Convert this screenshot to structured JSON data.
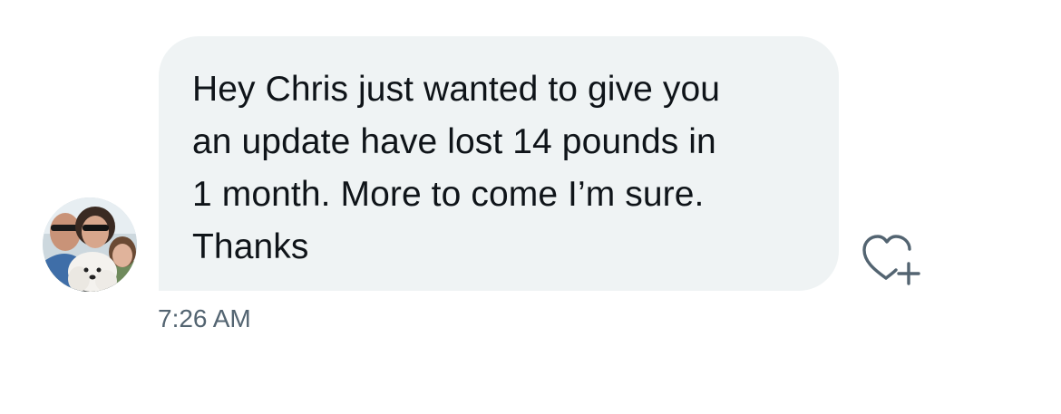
{
  "conversation": {
    "message": {
      "lines": [
        "Hey Chris just wanted to give you",
        "an update have lost 14 pounds in",
        "1 month. More to come I’m sure.",
        "Thanks"
      ],
      "timestamp": "7:26 AM"
    },
    "icons": {
      "avatar": "sender-avatar-photo",
      "react": "heart-plus-icon"
    },
    "colors": {
      "bubble_background": "#eff3f4",
      "text": "#0f1419",
      "secondary_text": "#536471",
      "icon": "#536471"
    }
  }
}
